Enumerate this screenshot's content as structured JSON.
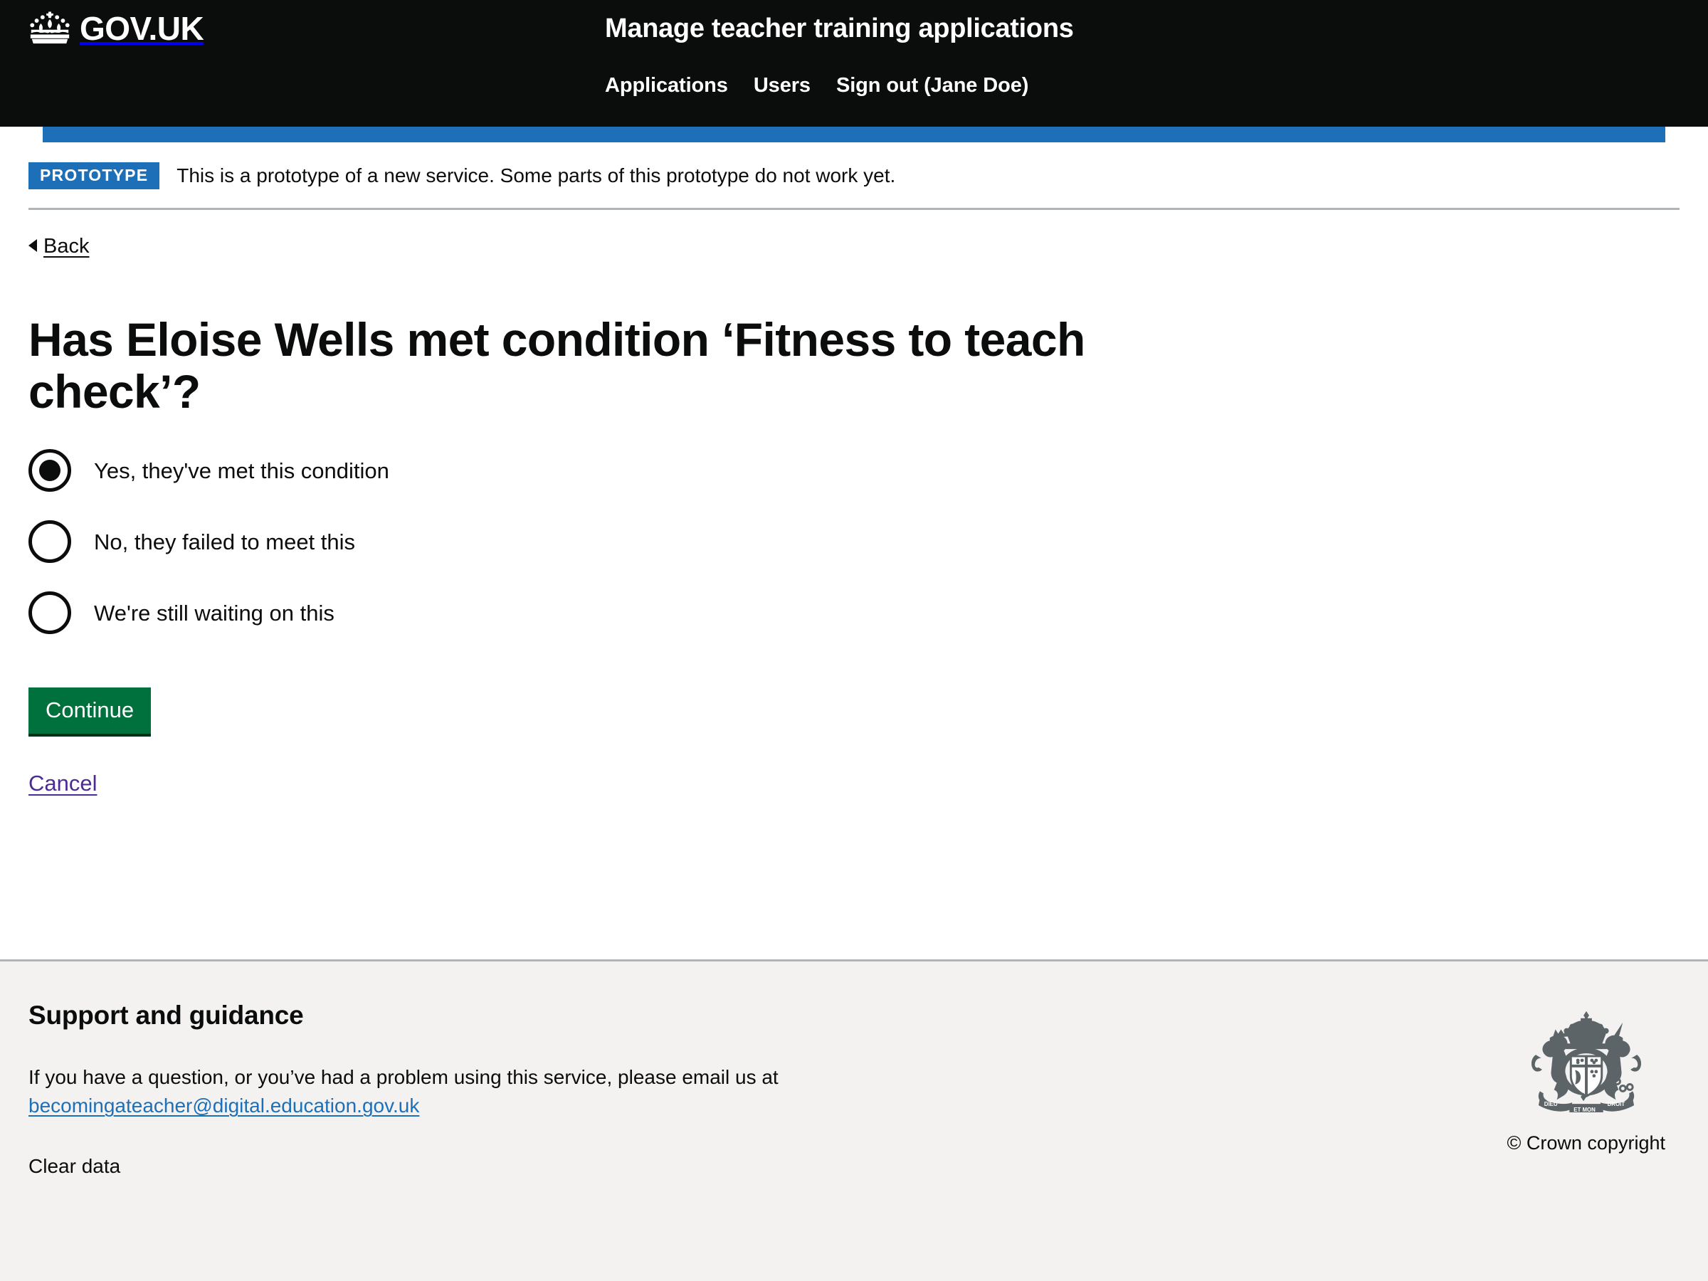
{
  "header": {
    "logo_text": "GOV.UK",
    "logo_icon": "gov-uk-crown-icon",
    "service_name": "Manage teacher training applications",
    "nav": [
      {
        "label": "Applications"
      },
      {
        "label": "Users"
      },
      {
        "label": "Sign out (Jane Doe)"
      }
    ],
    "accent_color": "#1d70b8",
    "background_color": "#0b0c0c"
  },
  "phase_banner": {
    "tag": "PROTOTYPE",
    "text": "This is a prototype of a new service. Some parts of this prototype do not work yet.",
    "tag_color": "#1d70b8"
  },
  "back_link": {
    "label": "Back",
    "icon": "chevron-left-icon"
  },
  "main": {
    "heading": "Has Eloise Wells met condition ‘Fitness to teach check’?",
    "radios": [
      {
        "label": "Yes, they've met this condition",
        "checked": true
      },
      {
        "label": "No, they failed to meet this",
        "checked": false
      },
      {
        "label": "We're still waiting on this",
        "checked": false
      }
    ],
    "continue_label": "Continue",
    "continue_color": "#00703c",
    "cancel_label": "Cancel",
    "cancel_color": "#4c2c92"
  },
  "footer": {
    "heading": "Support and guidance",
    "text_before_email": "If you have a question, or you’ve had a problem using this service, please email us at",
    "email": "becomingateacher@digital.education.gov.uk",
    "email_color": "#1d70b8",
    "clear_data_label": "Clear data",
    "crest_icon": "royal-coat-of-arms-icon",
    "copyright": "© Crown copyright",
    "background_color": "#f3f2f1"
  }
}
